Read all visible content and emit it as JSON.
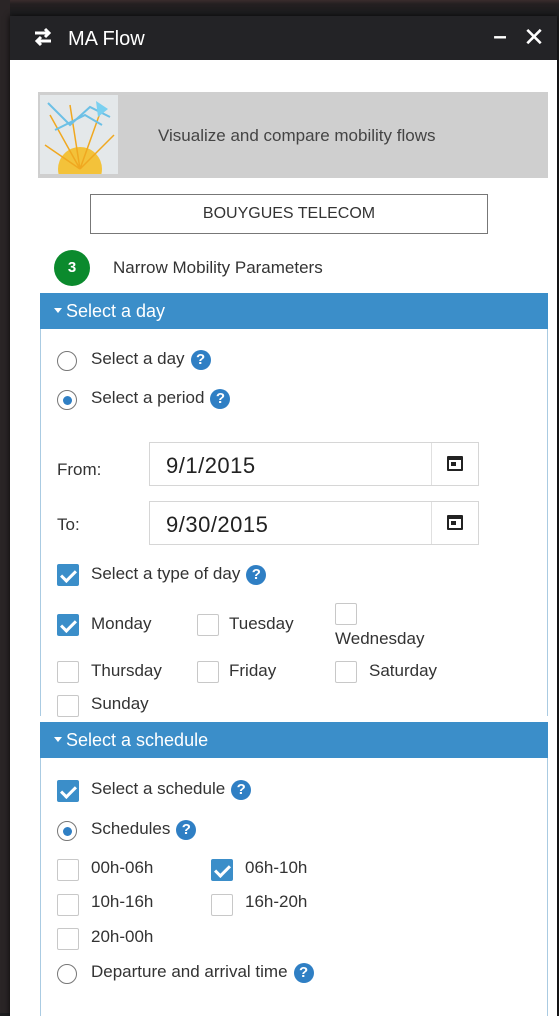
{
  "window": {
    "title": "MA Flow",
    "minimize": "–",
    "close": "✕",
    "icon": "arrows-exchange-icon"
  },
  "banner": {
    "text": "Visualize and compare mobility flows"
  },
  "operator": {
    "label": "BOUYGUES TELECOM"
  },
  "step": {
    "number": "3",
    "label": "Narrow Mobility Parameters"
  },
  "day_section": {
    "header": "Select a day",
    "option_day": {
      "label": "Select a day",
      "selected": false
    },
    "option_period": {
      "label": "Select a period",
      "selected": true
    },
    "from": {
      "label": "From:",
      "value": "9/1/2015"
    },
    "to": {
      "label": "To:",
      "value": "9/30/2015"
    },
    "type_of_day": {
      "label": "Select a type of day",
      "checked": true
    },
    "days": [
      {
        "label": "Monday",
        "checked": true
      },
      {
        "label": "Tuesday",
        "checked": false
      },
      {
        "label": "Wednesday",
        "checked": false
      },
      {
        "label": "Thursday",
        "checked": false
      },
      {
        "label": "Friday",
        "checked": false
      },
      {
        "label": "Saturday",
        "checked": false
      },
      {
        "label": "Sunday",
        "checked": false
      }
    ]
  },
  "schedule_section": {
    "header": "Select a schedule",
    "select_schedule": {
      "label": "Select a schedule",
      "checked": true
    },
    "schedules": {
      "label": "Schedules",
      "selected": true
    },
    "slots": [
      {
        "label": "00h-06h",
        "checked": false
      },
      {
        "label": "06h-10h",
        "checked": true
      },
      {
        "label": "10h-16h",
        "checked": false
      },
      {
        "label": "16h-20h",
        "checked": false
      },
      {
        "label": "20h-00h",
        "checked": false
      }
    ],
    "departure_arrival": {
      "label": "Departure and arrival time",
      "selected": false
    }
  },
  "help_glyph": "?"
}
